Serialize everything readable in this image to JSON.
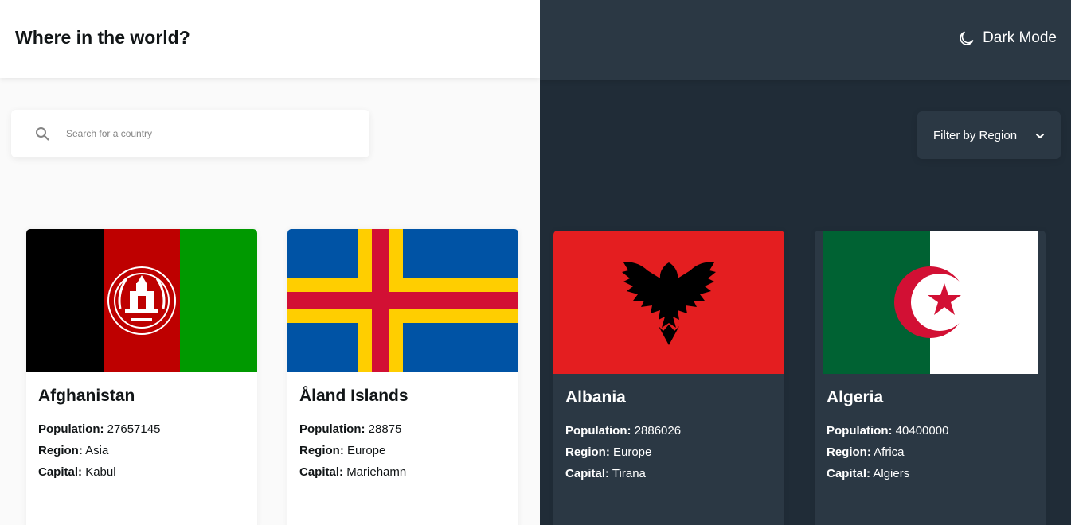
{
  "header": {
    "title": "Where in the world?",
    "theme_toggle_label": "Dark Mode",
    "theme_toggle_icon": "moon-icon"
  },
  "search": {
    "placeholder": "Search for a country",
    "value": "",
    "icon": "search-icon"
  },
  "filter": {
    "label": "Filter by Region",
    "icon": "chevron-down-icon"
  },
  "colors": {
    "light_bg": "#fafafa",
    "light_element": "#ffffff",
    "dark_bg": "#202c37",
    "dark_element": "#2b3844",
    "text_dark": "#111517"
  },
  "labels": {
    "population": "Population:",
    "region": "Region:",
    "capital": "Capital:"
  },
  "countries": [
    {
      "name": "Afghanistan",
      "population": "27657145",
      "region": "Asia",
      "capital": "Kabul",
      "flag": "afghanistan-flag"
    },
    {
      "name": "Åland Islands",
      "population": "28875",
      "region": "Europe",
      "capital": "Mariehamn",
      "flag": "aland-islands-flag"
    },
    {
      "name": "Albania",
      "population": "2886026",
      "region": "Europe",
      "capital": "Tirana",
      "flag": "albania-flag"
    },
    {
      "name": "Algeria",
      "population": "40400000",
      "region": "Africa",
      "capital": "Algiers",
      "flag": "algeria-flag"
    }
  ]
}
